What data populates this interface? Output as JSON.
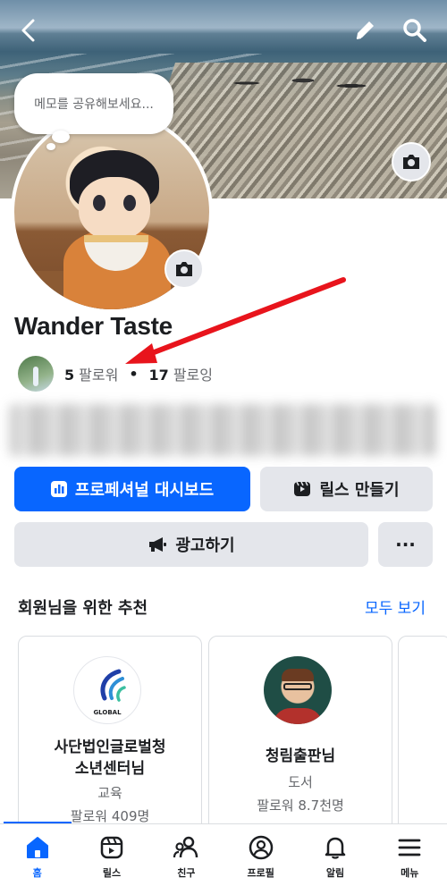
{
  "header": {
    "back_icon": "chevron-left-icon",
    "edit_icon": "pencil-icon",
    "search_icon": "search-icon"
  },
  "note_bubble": {
    "placeholder": "메모를 공유해보세요..."
  },
  "profile": {
    "name": "Wander Taste",
    "followers_count": "5",
    "followers_label": "팔로워",
    "following_count": "17",
    "following_label": "팔로잉"
  },
  "actions": {
    "dashboard_label": "프로페셔널 대시보드",
    "reels_label": "릴스 만들기",
    "ads_label": "광고하기",
    "more_label": "···"
  },
  "recommendations": {
    "title": "회원님을 위한 추천",
    "see_all": "모두 보기",
    "cards": [
      {
        "name_line1": "사단법인글로벌청",
        "name_line2": "소년센터님",
        "category": "교육",
        "followers": "팔로워 409명",
        "logo_text": "GLOBAL"
      },
      {
        "name_line1": "청림출판님",
        "category": "도서",
        "followers": "팔로워 8.7천명"
      }
    ]
  },
  "bottom_nav": [
    {
      "label": "홈",
      "icon": "home-icon",
      "active": true
    },
    {
      "label": "릴스",
      "icon": "reels-icon",
      "active": false
    },
    {
      "label": "친구",
      "icon": "friends-icon",
      "active": false
    },
    {
      "label": "프로필",
      "icon": "profile-icon",
      "active": false
    },
    {
      "label": "알림",
      "icon": "bell-icon",
      "active": false
    },
    {
      "label": "메뉴",
      "icon": "menu-icon",
      "active": false
    }
  ],
  "colors": {
    "brand_blue": "#0866ff",
    "secondary_button": "#e4e6eb",
    "annotation_arrow": "#e8141c"
  }
}
